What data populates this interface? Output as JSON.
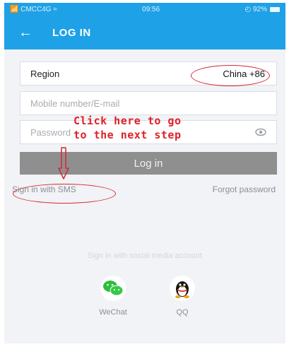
{
  "status": {
    "carrier": "📶 CMCC4G ≈",
    "time": "09:56",
    "battery": "◴ 92%"
  },
  "appbar": {
    "back_icon": "←",
    "title": "LOG IN"
  },
  "form": {
    "region_label": "Region",
    "region_value": "China +86",
    "mobile_placeholder": "Mobile number/E-mail",
    "password_placeholder": "Password",
    "login_label": "Log in"
  },
  "links": {
    "sms": "Sign in with SMS",
    "forgot": "Forgot password"
  },
  "social": {
    "title": "Sign in with social media account",
    "items": [
      {
        "label": "WeChat",
        "icon": "wechat-icon"
      },
      {
        "label": "QQ",
        "icon": "qq-icon"
      }
    ]
  },
  "annotation": {
    "line1": "Click here to go",
    "line2": "to the next step",
    "color": "#e0202a"
  },
  "colors": {
    "accent": "#1ea1e6",
    "button": "#8f8f8f"
  }
}
